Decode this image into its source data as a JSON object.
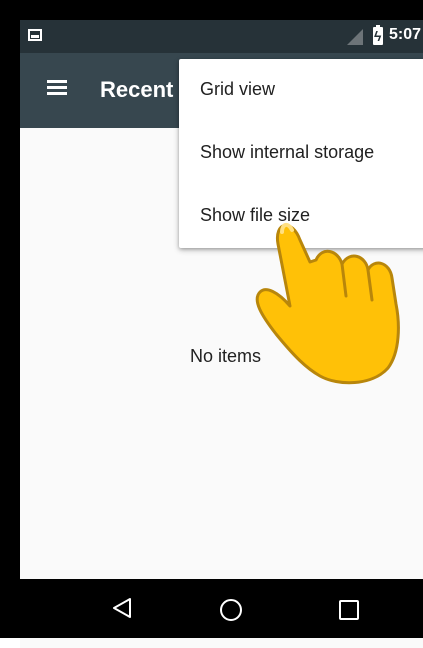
{
  "status_bar": {
    "time": "5:07",
    "icons": [
      "gallery-icon",
      "signal-icon",
      "battery-charging-icon"
    ]
  },
  "toolbar": {
    "menu_icon": "hamburger-icon",
    "title": "Recent"
  },
  "main": {
    "empty_text": "No items"
  },
  "overflow_menu": {
    "items": [
      {
        "label": "Grid view"
      },
      {
        "label": "Show internal storage"
      },
      {
        "label": "Show file size"
      }
    ]
  },
  "navigation_bar": {
    "icons": [
      "back-icon",
      "home-icon",
      "recents-icon"
    ]
  },
  "overlay": {
    "icon": "pointing-hand-icon"
  },
  "colors": {
    "status_bar": "#263238",
    "toolbar": "#37474f",
    "background": "#fafafa",
    "hand": "#ffc107"
  }
}
